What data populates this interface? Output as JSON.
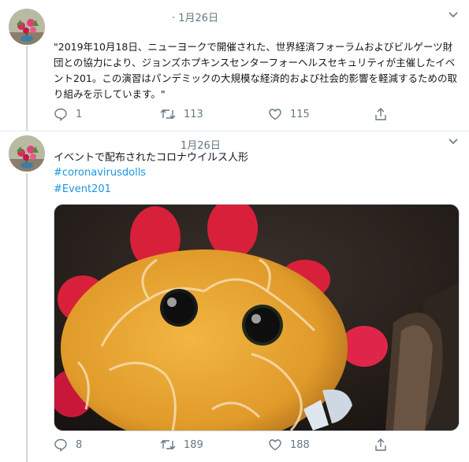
{
  "tweets": [
    {
      "date": "1月26日",
      "text": "\"2019年10月18日、ニューヨークで開催された、世界経済フォーラムおよびビルゲーツ財団との協力により、ジョンズホプキンスセンターフォーヘルスセキュリティが主催したイベント201。この演習はパンデミックの大規模な経済的および社会的影響を軽減するための取り組みを示しています。\"",
      "replies": "1",
      "retweets": "113",
      "likes": "115"
    },
    {
      "date": "1月26日",
      "text": "イベントで配布されたコロナウイルス人形",
      "hashtags": [
        "#coronavirusdolls",
        "#Event201"
      ],
      "replies": "8",
      "retweets": "189",
      "likes": "188"
    }
  ],
  "colors": {
    "link": "#1b95e0",
    "meta": "#657786",
    "line": "#ccd6dd"
  },
  "icons": [
    "avatar-flowers",
    "chevron-down-icon",
    "reply-icon",
    "retweet-icon",
    "like-icon",
    "share-icon"
  ]
}
